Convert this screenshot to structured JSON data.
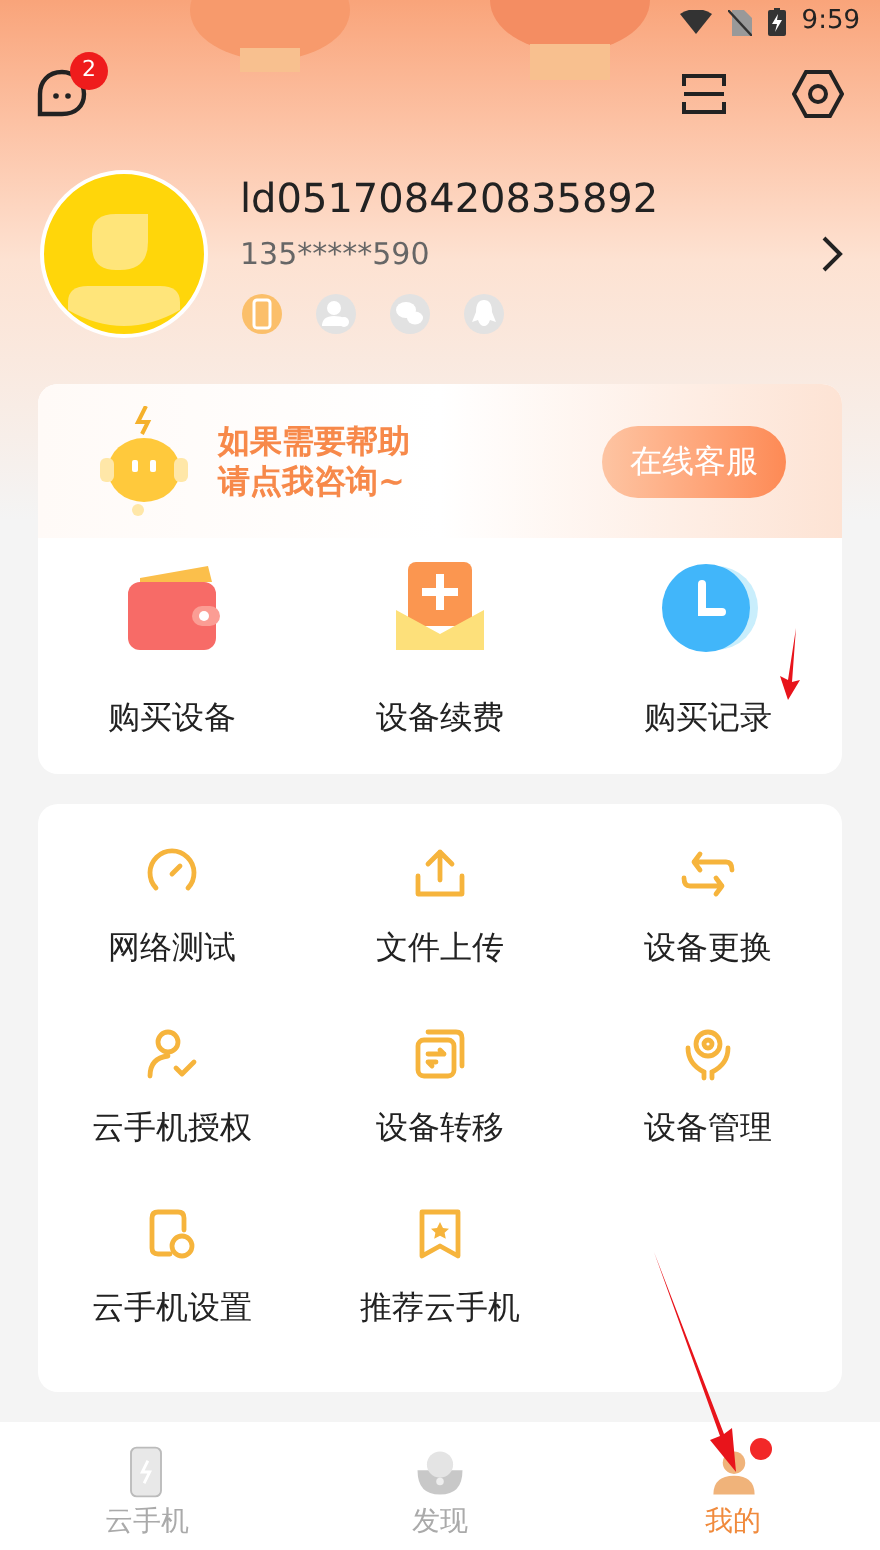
{
  "status_bar": {
    "time": "9:59"
  },
  "header": {
    "message_badge": "2"
  },
  "profile": {
    "user_id": "ld051708420835892",
    "phone": "135*****590",
    "login_methods": [
      {
        "kind": "phone",
        "bound": true
      },
      {
        "kind": "contact",
        "bound": false
      },
      {
        "kind": "wechat",
        "bound": false
      },
      {
        "kind": "qq",
        "bound": false
      }
    ]
  },
  "support_banner": {
    "lines": [
      "如果需要帮助",
      "请点我咨询~"
    ],
    "button": "在线客服"
  },
  "quick_actions": [
    {
      "kind": "wallet",
      "label": "购买设备"
    },
    {
      "kind": "renew",
      "label": "设备续费"
    },
    {
      "kind": "clock",
      "label": "购买记录"
    }
  ],
  "tools": [
    {
      "kind": "speed",
      "label": "网络测试"
    },
    {
      "kind": "upload",
      "label": "文件上传"
    },
    {
      "kind": "swap",
      "label": "设备更换"
    },
    {
      "kind": "authorize",
      "label": "云手机授权"
    },
    {
      "kind": "transfer",
      "label": "设备转移"
    },
    {
      "kind": "manage",
      "label": "设备管理"
    },
    {
      "kind": "settings",
      "label": "云手机设置"
    },
    {
      "kind": "recommend",
      "label": "推荐云手机"
    }
  ],
  "tab_bar": [
    {
      "kind": "phone",
      "label": "云手机",
      "selected": false,
      "dot": false
    },
    {
      "kind": "discover",
      "label": "发现",
      "selected": false,
      "dot": false
    },
    {
      "kind": "me",
      "label": "我的",
      "selected": true,
      "dot": true
    }
  ]
}
